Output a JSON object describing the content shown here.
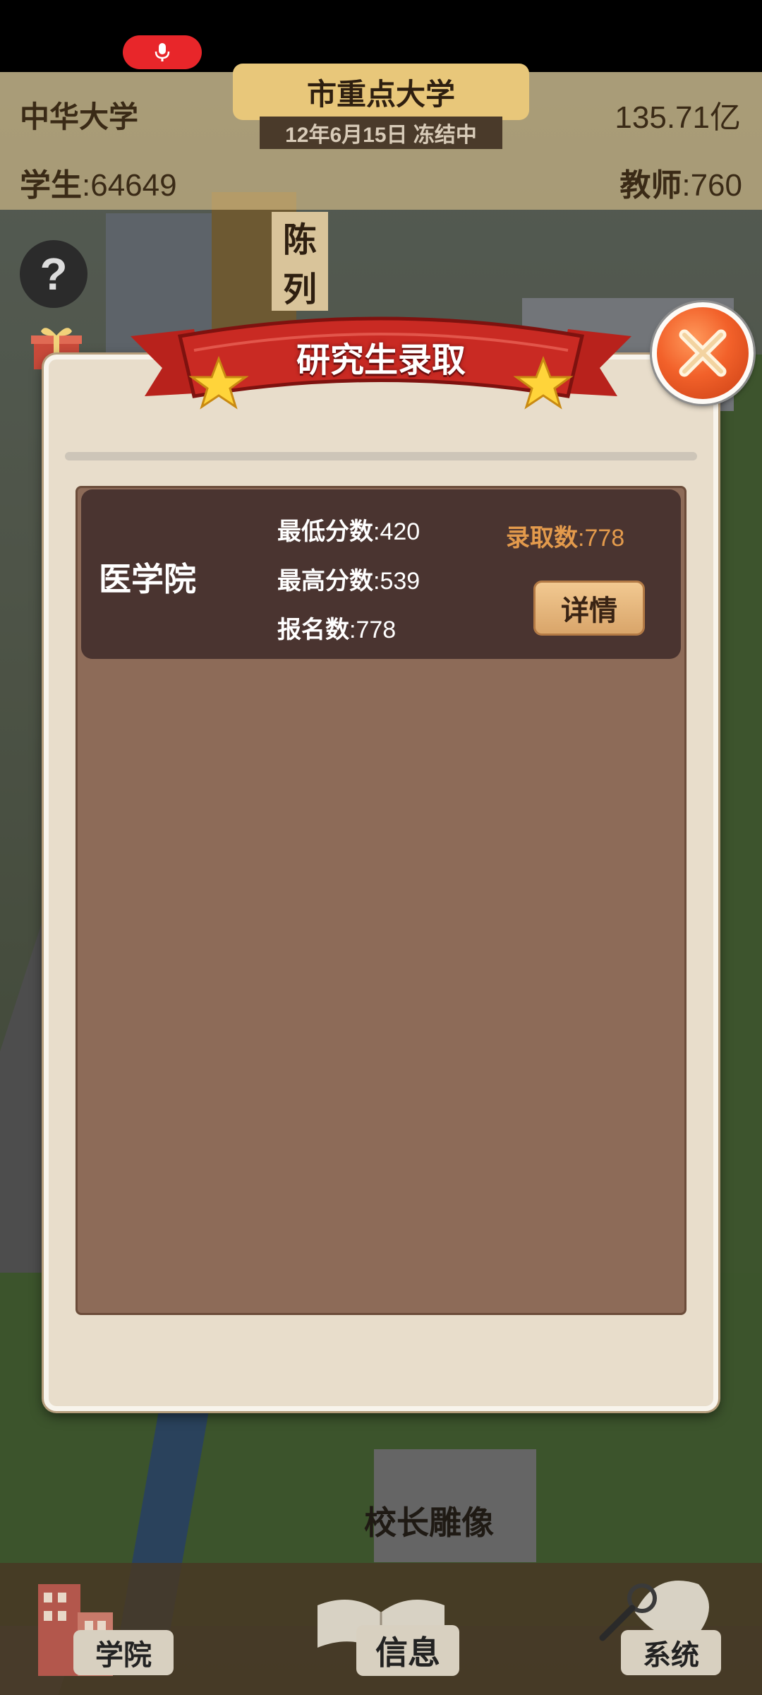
{
  "status_bar": {
    "mic_icon": "microphone-icon"
  },
  "hud": {
    "school_name": "中华大学",
    "money": "135.71亿",
    "students_label": "学生",
    "students_value": ":64649",
    "teachers_label": "教师",
    "teachers_value": ":760",
    "level": "市重点大学",
    "date_status": "12年6月15日 冻结中",
    "exhibit_sign": "陈列"
  },
  "scene": {
    "statue_label": "校长雕像"
  },
  "dialog": {
    "title": "研究生录取",
    "rows": [
      {
        "college": "医学院",
        "min_score_label": "最低分数",
        "min_score_value": ":420",
        "max_score_label": "最高分数",
        "max_score_value": ":539",
        "applicants_label": "报名数",
        "applicants_value": ":778",
        "admitted_label": "录取数",
        "admitted_value": ":778",
        "detail_button": "详情"
      }
    ]
  },
  "bottom_nav": {
    "college": "学院",
    "info": "信息",
    "system": "系统"
  },
  "colors": {
    "banner_red": "#c92a23",
    "close_orange": "#f2612a",
    "row_bg": "#4a3430",
    "panel_bg": "#8d6b58",
    "admitted_orange": "#e39a4c",
    "dialog_bg": "#e8ddcb"
  }
}
